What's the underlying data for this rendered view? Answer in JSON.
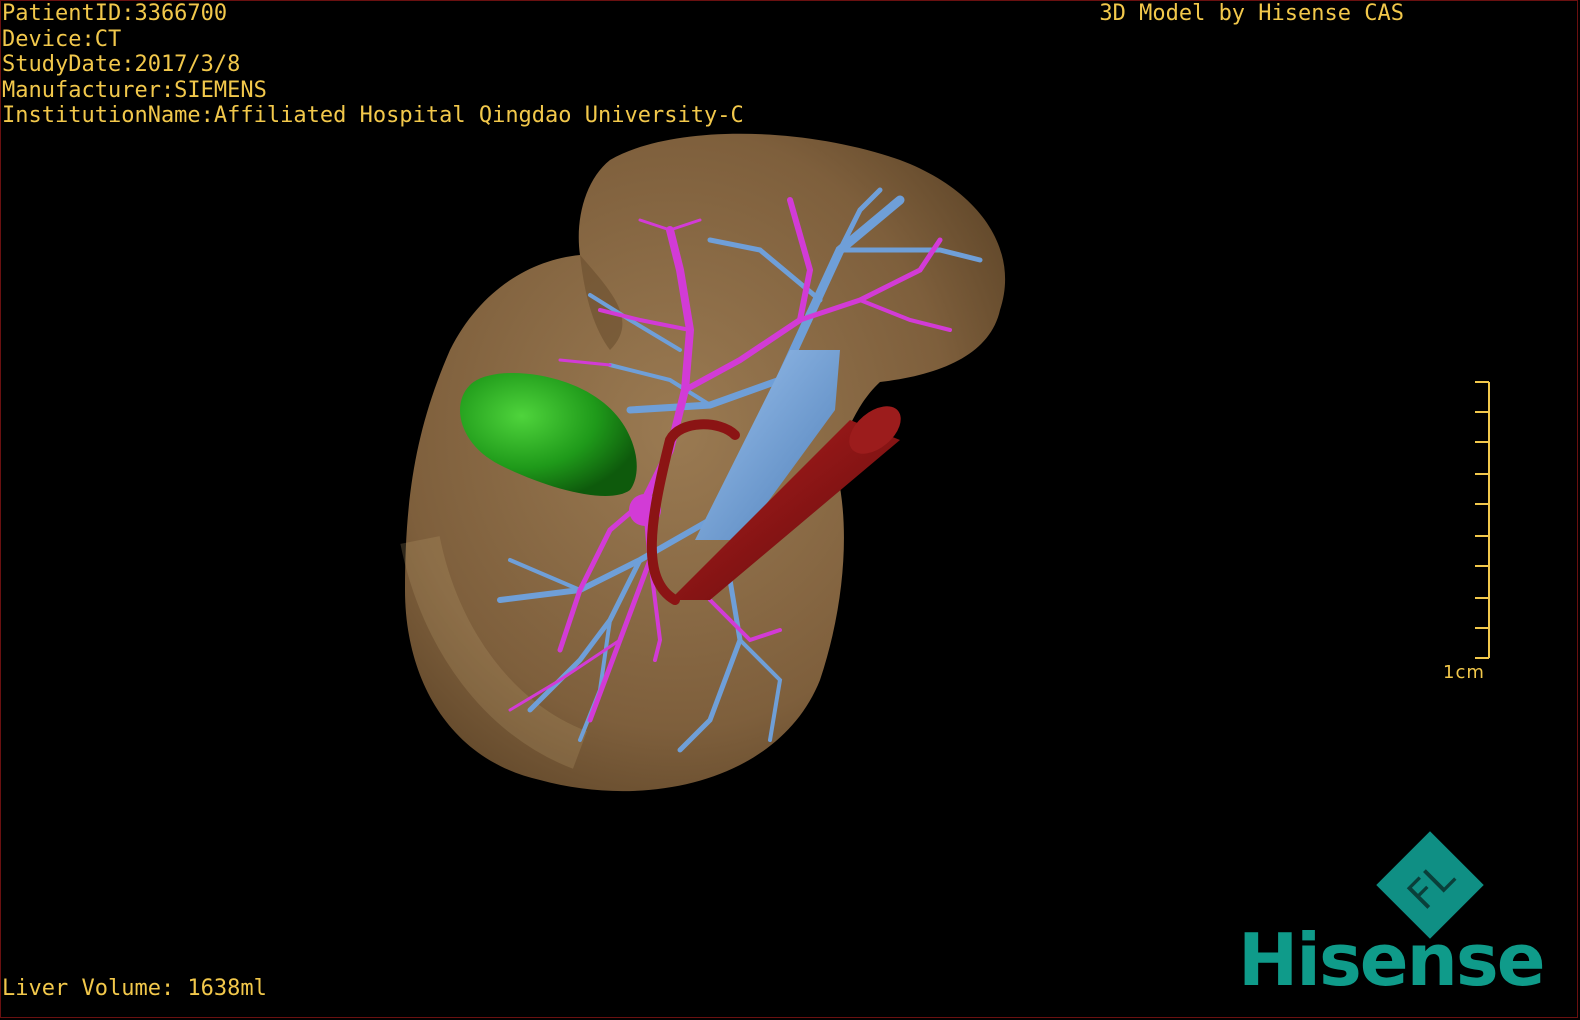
{
  "info": {
    "patient_id": "PatientID:3366700",
    "device": "Device:CT",
    "study_date": "StudyDate:2017/3/8",
    "manufacturer": "Manufacturer:SIEMENS",
    "institution": "InstitutionName:Affiliated Hospital Qingdao University-C"
  },
  "brand_title": "3D Model by Hisense CAS",
  "liver_volume": "Liver Volume: 1638ml",
  "scale": {
    "label": "1cm"
  },
  "logo": {
    "mark": "FL",
    "word": "Hisense"
  },
  "colors": {
    "text": "#f2c84b",
    "liver": "#8a6a45",
    "gallbladder": "#1f9a1a",
    "portal_vein": "#6f9fd8",
    "hepatic_vein": "#d23bd6",
    "artery": "#8b1414",
    "brand": "#0f9b8a"
  }
}
